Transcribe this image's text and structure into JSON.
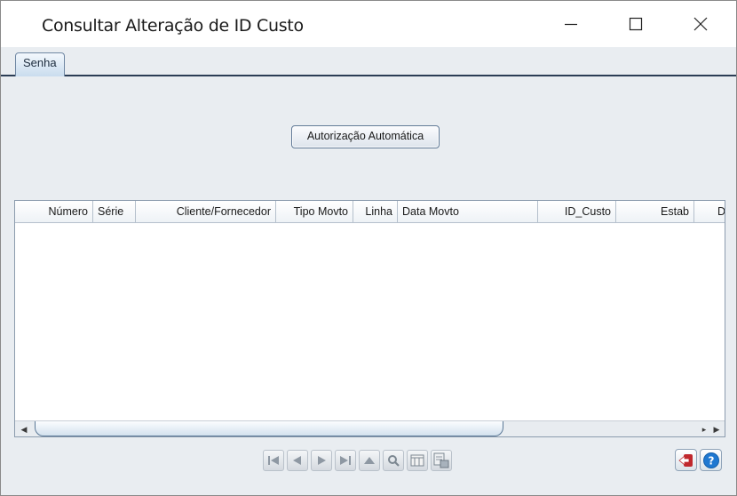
{
  "window": {
    "title": "Consultar Alteração de ID Custo"
  },
  "tabs": [
    {
      "label": "Senha"
    }
  ],
  "actions": {
    "auto_auth_label": "Autorização Automática"
  },
  "grid": {
    "columns": [
      {
        "label": "Número",
        "align": "right"
      },
      {
        "label": "Série",
        "align": "left"
      },
      {
        "label": "Cliente/Fornecedor",
        "align": "right"
      },
      {
        "label": "Tipo Movto",
        "align": "right"
      },
      {
        "label": "Linha",
        "align": "right"
      },
      {
        "label": "Data Movto",
        "align": "left"
      },
      {
        "label": "ID_Custo",
        "align": "right"
      },
      {
        "label": "Estab",
        "align": "right"
      },
      {
        "label": "D",
        "align": "right"
      }
    ],
    "rows": []
  },
  "navigation": {
    "buttons": [
      "first-record-icon",
      "previous-record-icon",
      "next-record-icon",
      "last-record-icon",
      "go-to-icon",
      "search-icon",
      "list-view-icon",
      "export-icon"
    ]
  },
  "icons": {
    "exit": "exit-icon",
    "help": "help-icon"
  },
  "colors": {
    "background": "#e9edf1",
    "accent_border": "#2b3d55",
    "exit_red": "#c0282d",
    "help_blue": "#1f78d1"
  }
}
